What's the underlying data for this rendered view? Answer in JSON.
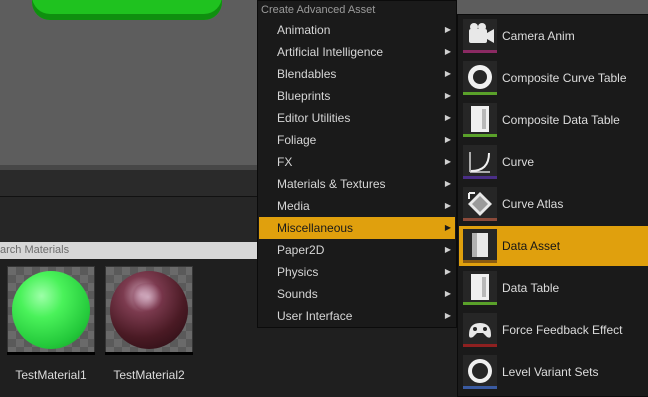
{
  "search": {
    "placeholder_text": "arch Materials"
  },
  "assets": [
    {
      "label": "TestMaterial1"
    },
    {
      "label": "TestMaterial2"
    }
  ],
  "menu": {
    "header": "Create Advanced Asset",
    "items": [
      {
        "label": "Animation"
      },
      {
        "label": "Artificial Intelligence"
      },
      {
        "label": "Blendables"
      },
      {
        "label": "Blueprints"
      },
      {
        "label": "Editor Utilities"
      },
      {
        "label": "Foliage"
      },
      {
        "label": "FX"
      },
      {
        "label": "Materials & Textures"
      },
      {
        "label": "Media"
      },
      {
        "label": "Miscellaneous",
        "active": true
      },
      {
        "label": "Paper2D"
      },
      {
        "label": "Physics"
      },
      {
        "label": "Sounds"
      },
      {
        "label": "User Interface"
      }
    ],
    "arrow_glyph": "▶"
  },
  "submenu": {
    "items": [
      {
        "label": "Camera Anim",
        "icon": "camera-anim-icon",
        "accent": "#8b2a63"
      },
      {
        "label": "Composite Curve Table",
        "icon": "composite-curve-table-icon",
        "accent": "#5aa12a"
      },
      {
        "label": "Composite Data Table",
        "icon": "composite-data-table-icon",
        "accent": "#5aa12a"
      },
      {
        "label": "Curve",
        "icon": "curve-icon",
        "accent": "#4a2e86"
      },
      {
        "label": "Curve Atlas",
        "icon": "curve-atlas-icon",
        "accent": "#8b4a3a"
      },
      {
        "label": "Data Asset",
        "icon": "data-asset-icon",
        "accent": "#8a5b10",
        "active": true
      },
      {
        "label": "Data Table",
        "icon": "data-table-icon",
        "accent": "#5aa12a"
      },
      {
        "label": "Force Feedback Effect",
        "icon": "force-feedback-icon",
        "accent": "#8e2020"
      },
      {
        "label": "Level Variant Sets",
        "icon": "level-variant-sets-icon",
        "accent": "#3a5aa0"
      }
    ]
  },
  "colors": {
    "highlight": "#e0a00d",
    "menu_bg": "#1a1a1a",
    "viewport_bg": "#5d5d5d"
  }
}
